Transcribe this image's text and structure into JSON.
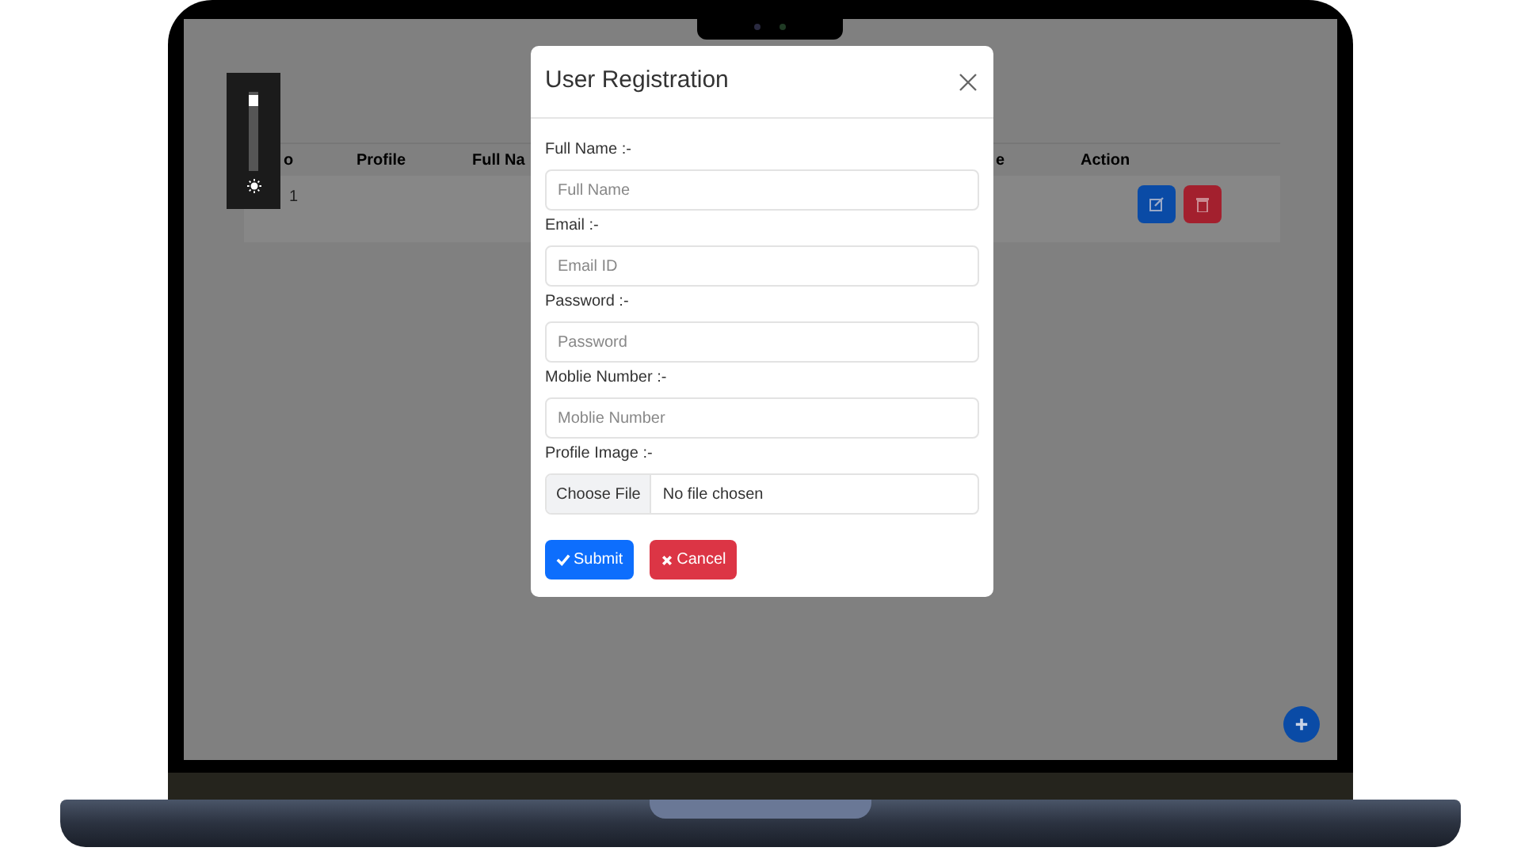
{
  "brightness": {
    "level": 0.95
  },
  "table": {
    "columns": [
      "o",
      "Profile",
      "Full Na",
      "e",
      "Action"
    ],
    "rows": [
      {
        "no": "1"
      }
    ]
  },
  "modal": {
    "title": "User Registration",
    "fields": [
      {
        "kind": "text",
        "label": "Full Name :-",
        "placeholder": "Full Name"
      },
      {
        "kind": "text",
        "label": "Email :-",
        "placeholder": "Email ID"
      },
      {
        "kind": "text",
        "label": "Password :-",
        "placeholder": "Password"
      },
      {
        "kind": "text",
        "label": "Moblie Number :-",
        "placeholder": "Moblie Number"
      },
      {
        "kind": "file",
        "label": "Profile Image :-",
        "button": "Choose File",
        "status": "No file chosen"
      }
    ],
    "buttons": [
      {
        "kind": "submit",
        "label": "Submit"
      },
      {
        "kind": "cancel",
        "label": "Cancel"
      }
    ]
  }
}
